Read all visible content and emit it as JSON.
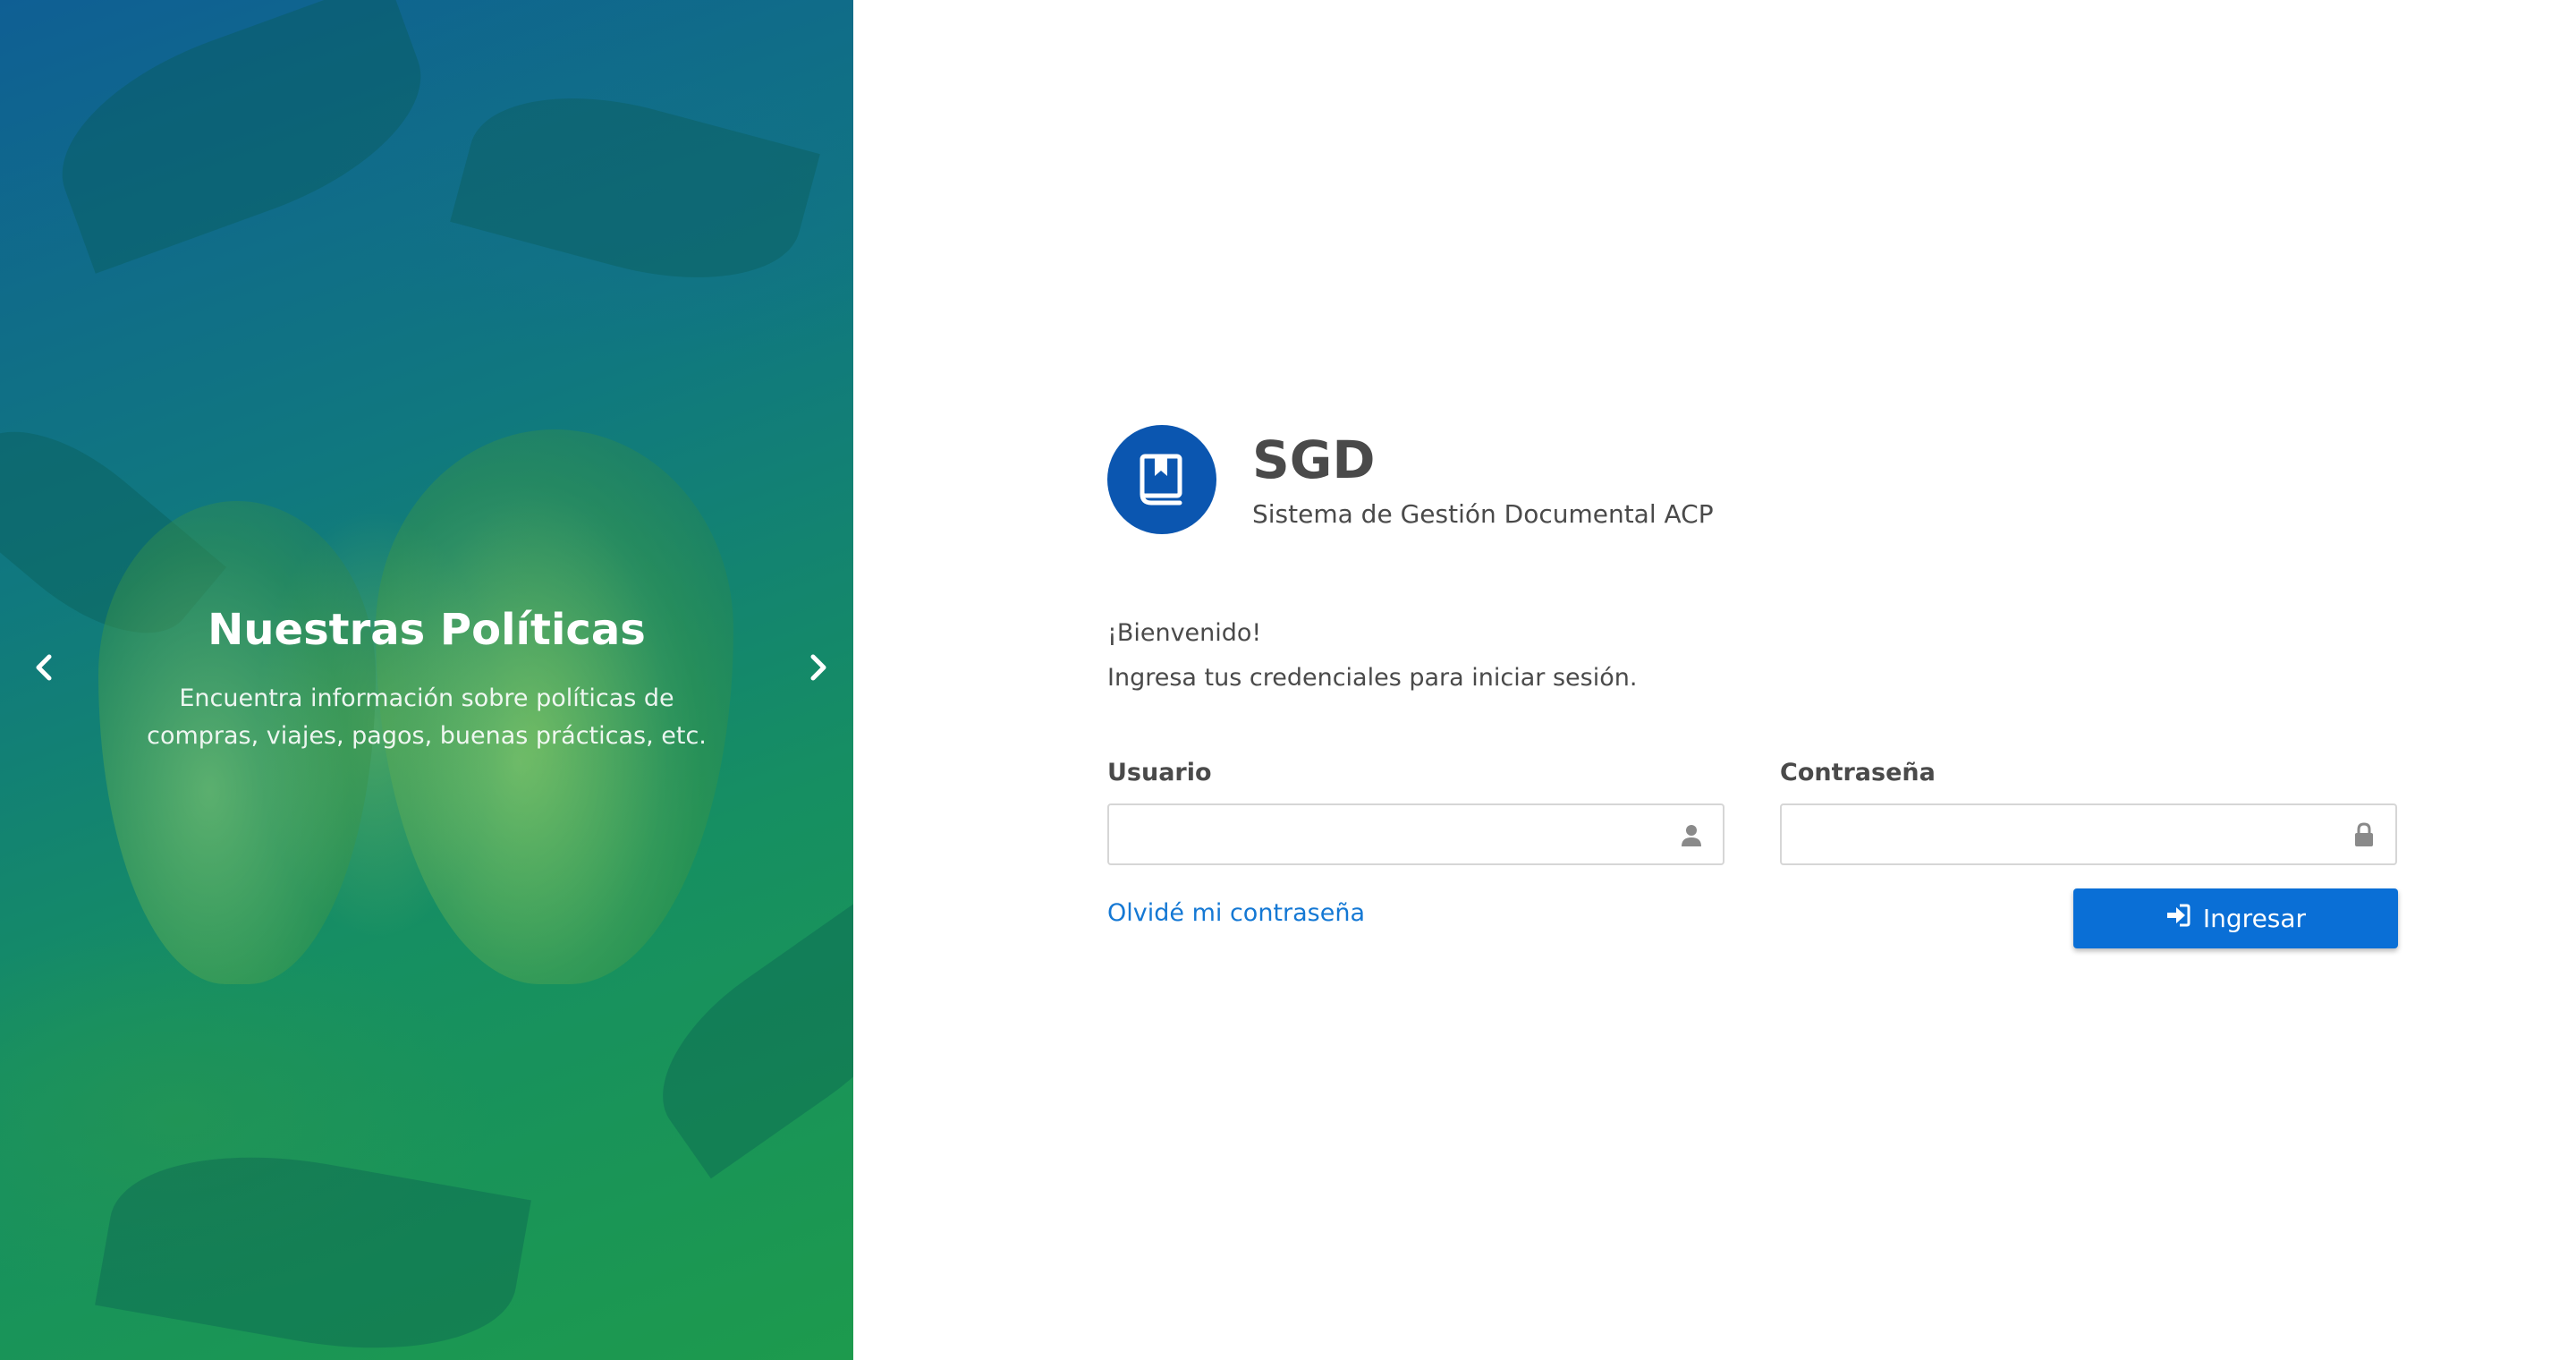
{
  "carousel": {
    "slide": {
      "title": "Nuestras Políticas",
      "description": "Encuentra información sobre políticas de compras, viajes, pagos, buenas prácticas, etc."
    },
    "prev_icon": "chevron-left-icon",
    "next_icon": "chevron-right-icon"
  },
  "brand": {
    "name": "SGD",
    "subtitle": "Sistema de Gestión Documental ACP",
    "logo_icon": "book-bookmark-icon",
    "logo_color": "#0b56b0"
  },
  "welcome": {
    "greeting": "¡Bienvenido!",
    "instructions": "Ingresa tus credenciales para iniciar sesión."
  },
  "form": {
    "username": {
      "label": "Usuario",
      "value": "",
      "icon": "user-icon"
    },
    "password": {
      "label": "Contraseña",
      "value": "",
      "icon": "lock-icon"
    },
    "forgot_password_label": "Olvidé mi contraseña",
    "submit_label": "Ingresar",
    "submit_icon": "sign-in-icon"
  },
  "colors": {
    "accent": "#0a6fd6",
    "link": "#1478d4",
    "text": "#4a4a4a"
  }
}
